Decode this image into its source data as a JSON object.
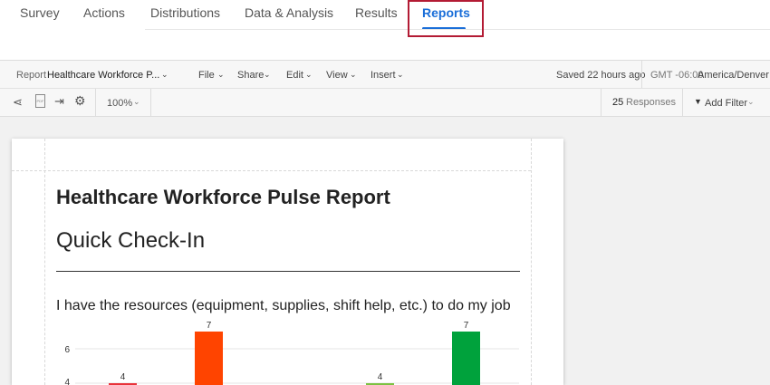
{
  "tabs": [
    "Survey",
    "Actions",
    "Distributions",
    "Data & Analysis",
    "Results",
    "Reports"
  ],
  "toolbar": {
    "report_prefix": "Report",
    "report_name": "Healthcare Workforce P...",
    "menus": [
      "File",
      "Share",
      "Edit",
      "View",
      "Insert"
    ],
    "saved": "Saved 22 hours ago",
    "tz_offset": "GMT -06:00",
    "tz_name": "America/Denver",
    "zoom": "100%",
    "responses_count": "25",
    "responses_label": "Responses",
    "add_filter": "Add Filter"
  },
  "report": {
    "title": "Healthcare Workforce Pulse Report",
    "subtitle": "Quick Check-In",
    "question": "I have the resources (equipment, supplies, shift help, etc.) to do my job"
  },
  "chart_data": {
    "type": "bar",
    "title": "I have the resources (equipment, supplies, shift help, etc.) to do my job",
    "y_ticks": [
      4,
      6
    ],
    "values": [
      4,
      7,
      4,
      7
    ],
    "colors": [
      "#e8333a",
      "#ff4400",
      "#7cc142",
      "#00a23c"
    ]
  }
}
